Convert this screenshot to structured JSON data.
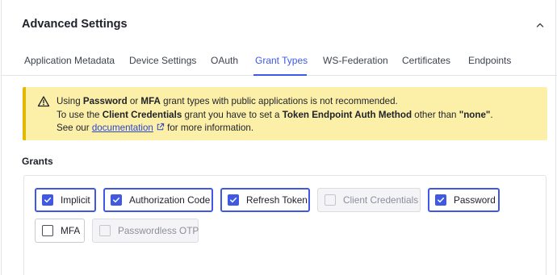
{
  "section": {
    "title": "Advanced Settings",
    "collapse_icon": "chevron-up-icon"
  },
  "tabs": [
    {
      "label": "Application Metadata",
      "active": false
    },
    {
      "label": "Device Settings",
      "active": false
    },
    {
      "label": "OAuth",
      "active": false
    },
    {
      "label": "Grant Types",
      "active": true
    },
    {
      "label": "WS-Federation",
      "active": false
    },
    {
      "label": "Certificates",
      "active": false
    },
    {
      "label": "Endpoints",
      "active": false
    }
  ],
  "alert": {
    "icon": "warning-triangle-icon",
    "line1": {
      "p1": "Using ",
      "b1": "Password",
      "p2": " or ",
      "b2": "MFA",
      "p3": " grant types with public applications is not recommended."
    },
    "line2": {
      "p1": "To use the ",
      "b1": "Client Credentials",
      "p2": " grant you have to set a ",
      "b2": "Token Endpoint Auth Method",
      "p3": " other than ",
      "b3": "\"none\"",
      "p4": "."
    },
    "line3": {
      "p1": "See our ",
      "link": "documentation",
      "p2": " for more information.",
      "link_icon": "external-link-icon"
    }
  },
  "grants": {
    "label": "Grants",
    "items": [
      {
        "label": "Implicit",
        "checked": true,
        "disabled": false
      },
      {
        "label": "Authorization Code",
        "checked": true,
        "disabled": false
      },
      {
        "label": "Refresh Token",
        "checked": true,
        "disabled": false
      },
      {
        "label": "Client Credentials",
        "checked": false,
        "disabled": true
      },
      {
        "label": "Password",
        "checked": true,
        "disabled": false
      },
      {
        "label": "MFA",
        "checked": false,
        "disabled": false
      },
      {
        "label": "Passwordless OTP",
        "checked": false,
        "disabled": true
      }
    ]
  },
  "colors": {
    "accent": "#3f59e4",
    "warning_bg": "#fcf0a8",
    "warning_border": "#e3b800"
  }
}
